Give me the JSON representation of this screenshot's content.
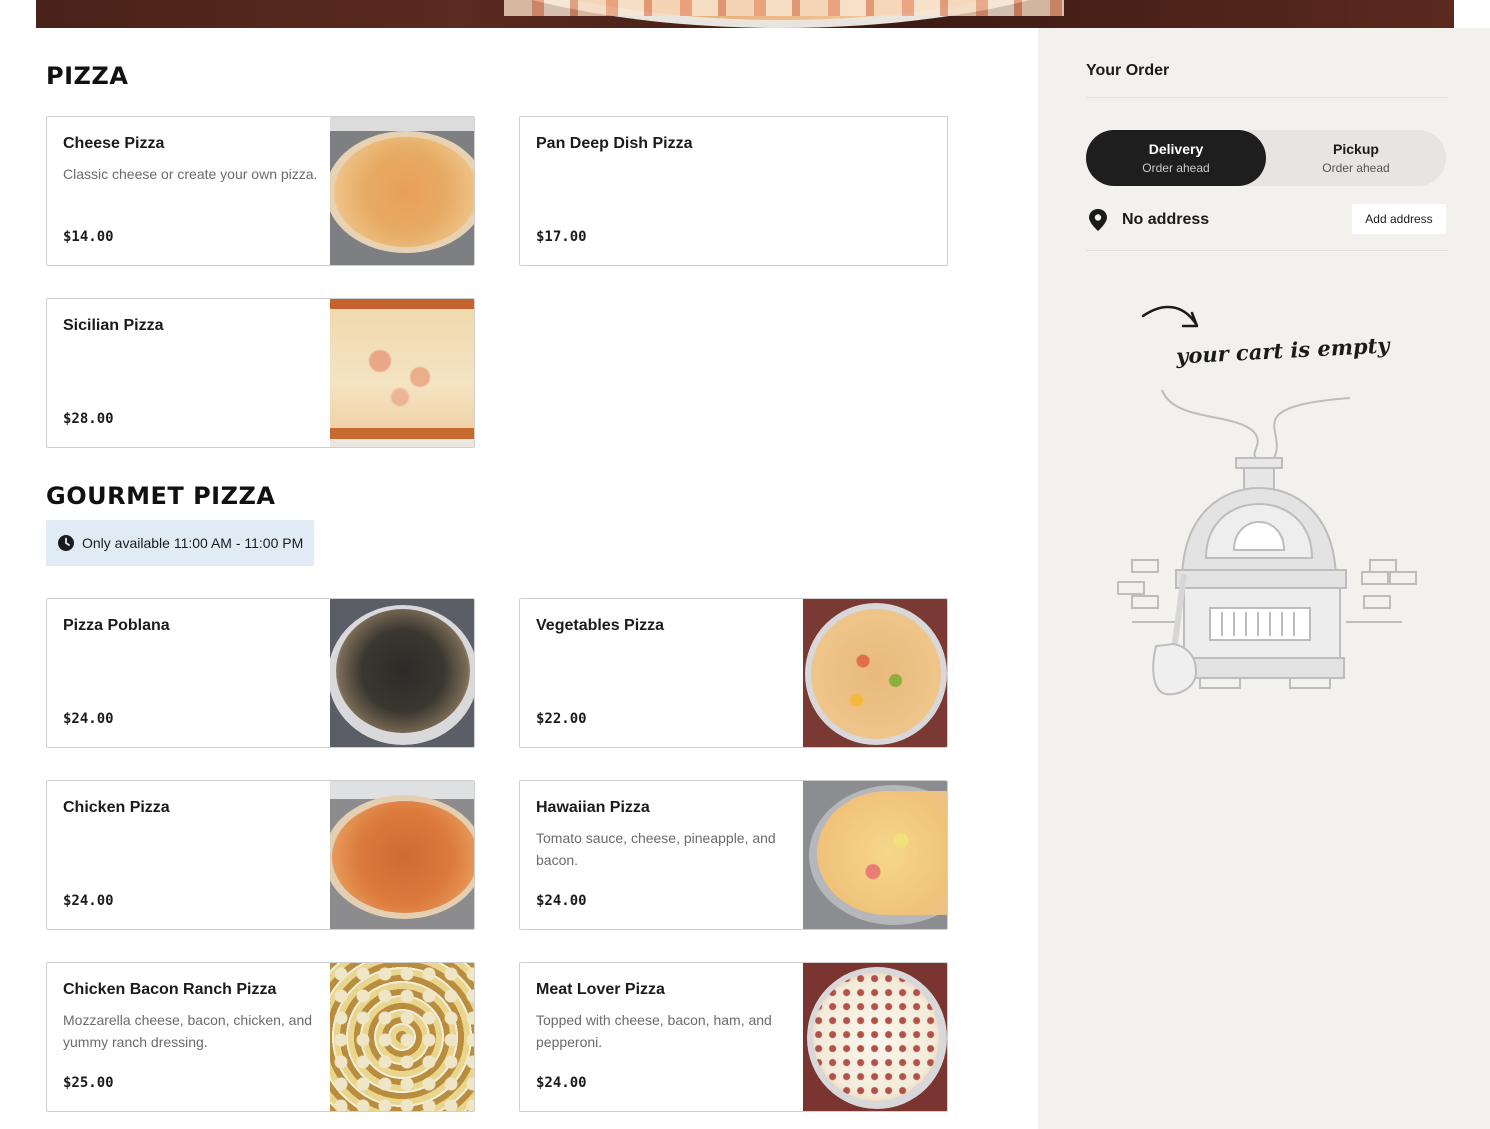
{
  "sections": [
    {
      "title": "PIZZA",
      "items": [
        {
          "name": "Cheese Pizza",
          "description": "Classic cheese or create your own pizza.",
          "price": "$14.00"
        },
        {
          "name": "Pan Deep Dish Pizza",
          "description": "",
          "price": "$17.00"
        },
        {
          "name": "Sicilian Pizza",
          "description": "",
          "price": "$28.00"
        }
      ]
    },
    {
      "title": "GOURMET PIZZA",
      "availability": "Only available 11:00 AM - 11:00 PM",
      "items": [
        {
          "name": "Pizza Poblana",
          "description": "",
          "price": "$24.00"
        },
        {
          "name": "Vegetables Pizza",
          "description": "",
          "price": "$22.00"
        },
        {
          "name": "Chicken Pizza",
          "description": "",
          "price": "$24.00"
        },
        {
          "name": "Hawaiian Pizza",
          "description": "Tomato sauce, cheese, pineapple, and bacon.",
          "price": "$24.00"
        },
        {
          "name": "Chicken Bacon Ranch Pizza",
          "description": "Mozzarella cheese, bacon, chicken, and yummy ranch dressing.",
          "price": "$25.00"
        },
        {
          "name": "Meat Lover Pizza",
          "description": "Topped with cheese, bacon, ham, and pepperoni.",
          "price": "$24.00"
        }
      ]
    }
  ],
  "order": {
    "title": "Your Order",
    "fulfillment": {
      "delivery": {
        "label": "Delivery",
        "sub": "Order ahead",
        "active": true
      },
      "pickup": {
        "label": "Pickup",
        "sub": "Order ahead",
        "active": false
      }
    },
    "address": {
      "text": "No address",
      "button": "Add address"
    },
    "empty_text": "your cart is empty"
  },
  "icons": {
    "availability": "clock-icon",
    "address": "map-pin-icon"
  },
  "colors": {
    "sidebar_bg": "#f2f1ee",
    "badge_bg": "#e1ebf6",
    "toggle_active": "#1e1e1e"
  }
}
